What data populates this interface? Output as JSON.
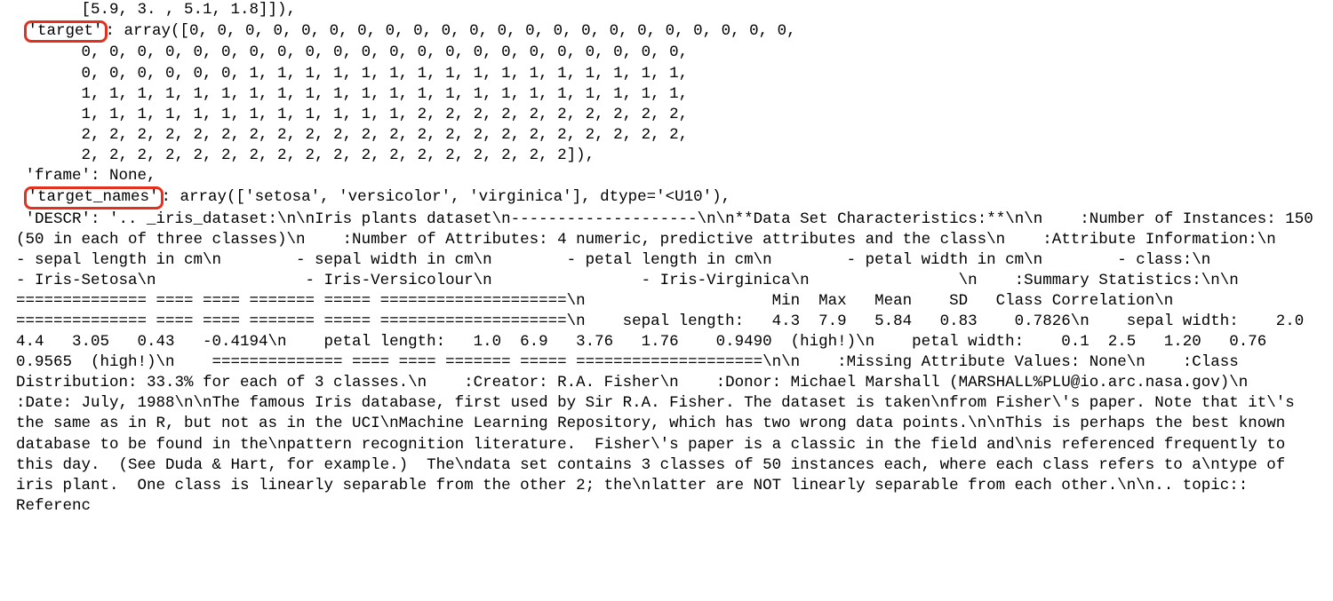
{
  "lines": {
    "l0": "       [5.9, 3. , 5.1, 1.8]]),",
    "l1a": " ",
    "l1b": "'target'",
    "l1c": ": array([0, 0, 0, 0, 0, 0, 0, 0, 0, 0, 0, 0, 0, 0, 0, 0, 0, 0, 0, 0, 0, 0,",
    "l2": "       0, 0, 0, 0, 0, 0, 0, 0, 0, 0, 0, 0, 0, 0, 0, 0, 0, 0, 0, 0, 0, 0,",
    "l3": "       0, 0, 0, 0, 0, 0, 1, 1, 1, 1, 1, 1, 1, 1, 1, 1, 1, 1, 1, 1, 1, 1,",
    "l4": "       1, 1, 1, 1, 1, 1, 1, 1, 1, 1, 1, 1, 1, 1, 1, 1, 1, 1, 1, 1, 1, 1,",
    "l5": "       1, 1, 1, 1, 1, 1, 1, 1, 1, 1, 1, 1, 2, 2, 2, 2, 2, 2, 2, 2, 2, 2,",
    "l6": "       2, 2, 2, 2, 2, 2, 2, 2, 2, 2, 2, 2, 2, 2, 2, 2, 2, 2, 2, 2, 2, 2,",
    "l7": "       2, 2, 2, 2, 2, 2, 2, 2, 2, 2, 2, 2, 2, 2, 2, 2, 2, 2]),",
    "l8": " 'frame': None,",
    "l9a": " ",
    "l9b": "'target_names'",
    "l9c": ": array(['setosa', 'versicolor', 'virginica'], dtype='<U10'),",
    "l10": " 'DESCR': '.. _iris_dataset:\\n\\nIris plants dataset\\n--------------------\\n\\n**Data Set Characteristics:**\\n\\n    :Number of Instances: 150 (50 in each of three classes)\\n    :Number of Attributes: 4 numeric, predictive attributes and the class\\n    :Attribute Information:\\n        - sepal length in cm\\n        - sepal width in cm\\n        - petal length in cm\\n        - petal width in cm\\n        - class:\\n                - Iris-Setosa\\n                - Iris-Versicolour\\n                - Iris-Virginica\\n                \\n    :Summary Statistics:\\n\\n    ============== ==== ==== ======= ===== ====================\\n                    Min  Max   Mean    SD   Class Correlation\\n    ============== ==== ==== ======= ===== ====================\\n    sepal length:   4.3  7.9   5.84   0.83    0.7826\\n    sepal width:    2.0  4.4   3.05   0.43   -0.4194\\n    petal length:   1.0  6.9   3.76   1.76    0.9490  (high!)\\n    petal width:    0.1  2.5   1.20   0.76    0.9565  (high!)\\n    ============== ==== ==== ======= ===== ====================\\n\\n    :Missing Attribute Values: None\\n    :Class Distribution: 33.3% for each of 3 classes.\\n    :Creator: R.A. Fisher\\n    :Donor: Michael Marshall (MARSHALL%PLU@io.arc.nasa.gov)\\n    :Date: July, 1988\\n\\nThe famous Iris database, first used by Sir R.A. Fisher. The dataset is taken\\nfrom Fisher\\'s paper. Note that it\\'s the same as in R, but not as in the UCI\\nMachine Learning Repository, which has two wrong data points.\\n\\nThis is perhaps the best known database to be found in the\\npattern recognition literature.  Fisher\\'s paper is a classic in the field and\\nis referenced frequently to this day.  (See Duda & Hart, for example.)  The\\ndata set contains 3 classes of 50 instances each, where each class refers to a\\ntype of iris plant.  One class is linearly separable from the other 2; the\\nlatter are NOT linearly separable from each other.\\n\\n.. topic:: Referenc"
  },
  "highlights": {
    "target": "'target'",
    "target_names": "'target_names'"
  }
}
